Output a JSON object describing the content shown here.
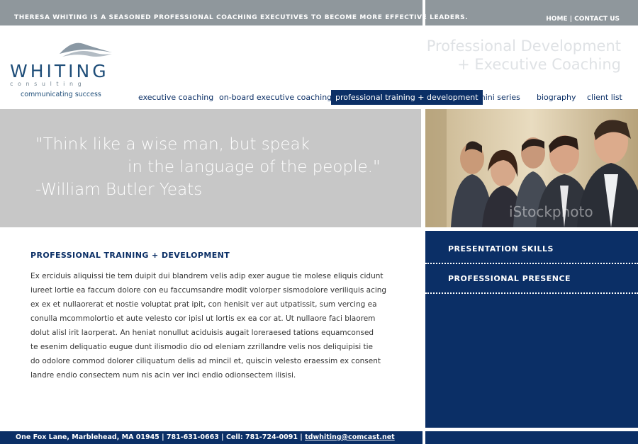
{
  "header": {
    "tagline": "THERESA WHITING IS A SEASONED PROFESSIONAL COACHING EXECUTIVES TO BECOME MORE EFFECTIVE LEADERS.",
    "top_links": {
      "home": "HOME",
      "separator": " | ",
      "contact": "CONTACT US"
    },
    "headline_line1": "Professional Development",
    "headline_line2": "+ Executive Coaching"
  },
  "logo": {
    "word": "WHITING",
    "consulting": "consulting",
    "sub": "communicating success"
  },
  "nav": {
    "items": [
      {
        "label": "executive coaching"
      },
      {
        "label": "on-board executive coaching"
      },
      {
        "label": "professional training + development"
      },
      {
        "label": "mini series"
      },
      {
        "label": "biography"
      },
      {
        "label": "client list"
      }
    ],
    "active_index": 2
  },
  "quote": {
    "line1": "\"Think like a wise man, but speak",
    "line2": "in the language of the people.\"",
    "line3": "-William Butler Yeats"
  },
  "photo": {
    "watermark": "iStockphoto"
  },
  "content": {
    "title": "PROFESSIONAL TRAINING + DEVELOPMENT",
    "lines": [
      "Ex erciduis aliquissi tie tem duipit dui blandrem velis adip exer augue tie molese eliquis cidunt",
      "iureet lortie ea faccum dolore con eu faccumsandre modit volorper sismodolore veriliquis acing",
      "ex ex et nullaorerat et nostie voluptat prat ipit, con henisit ver aut utpatissit, sum vercing ea",
      "conulla mcommolortio et aute velesto cor ipisl ut lortis ex ea cor at. Ut nullaore faci blaorem",
      "dolut alisl irit laorperat. An heniat nonullut aciduisis augait loreraesed tations equamconsed",
      "te esenim deliquatio eugue dunt ilismodio dio od eleniam zzrillandre velis nos deliquipisi tie",
      "do odolore commod dolorer ciliquatum delis ad mincil et, quiscin velesto eraessim ex consent",
      "landre endio consectem num nis acin ver inci endio odionsectem ilisisi."
    ]
  },
  "side_panel": {
    "items": [
      {
        "label": "PRESENTATION SKILLS"
      },
      {
        "label": "PROFESSIONAL PRESENCE"
      }
    ]
  },
  "footer": {
    "address": "One Fox Lane, Marblehead, MA 01945  |  781-631-0663  |  Cell: 781-724-0091  |  ",
    "email": "tdwhiting@comcast.net"
  },
  "colors": {
    "navy": "#0b2f66",
    "gray_bar": "#8f979c",
    "quote_gray": "#c7c7c7",
    "headline_gray": "#dfe2e5"
  }
}
